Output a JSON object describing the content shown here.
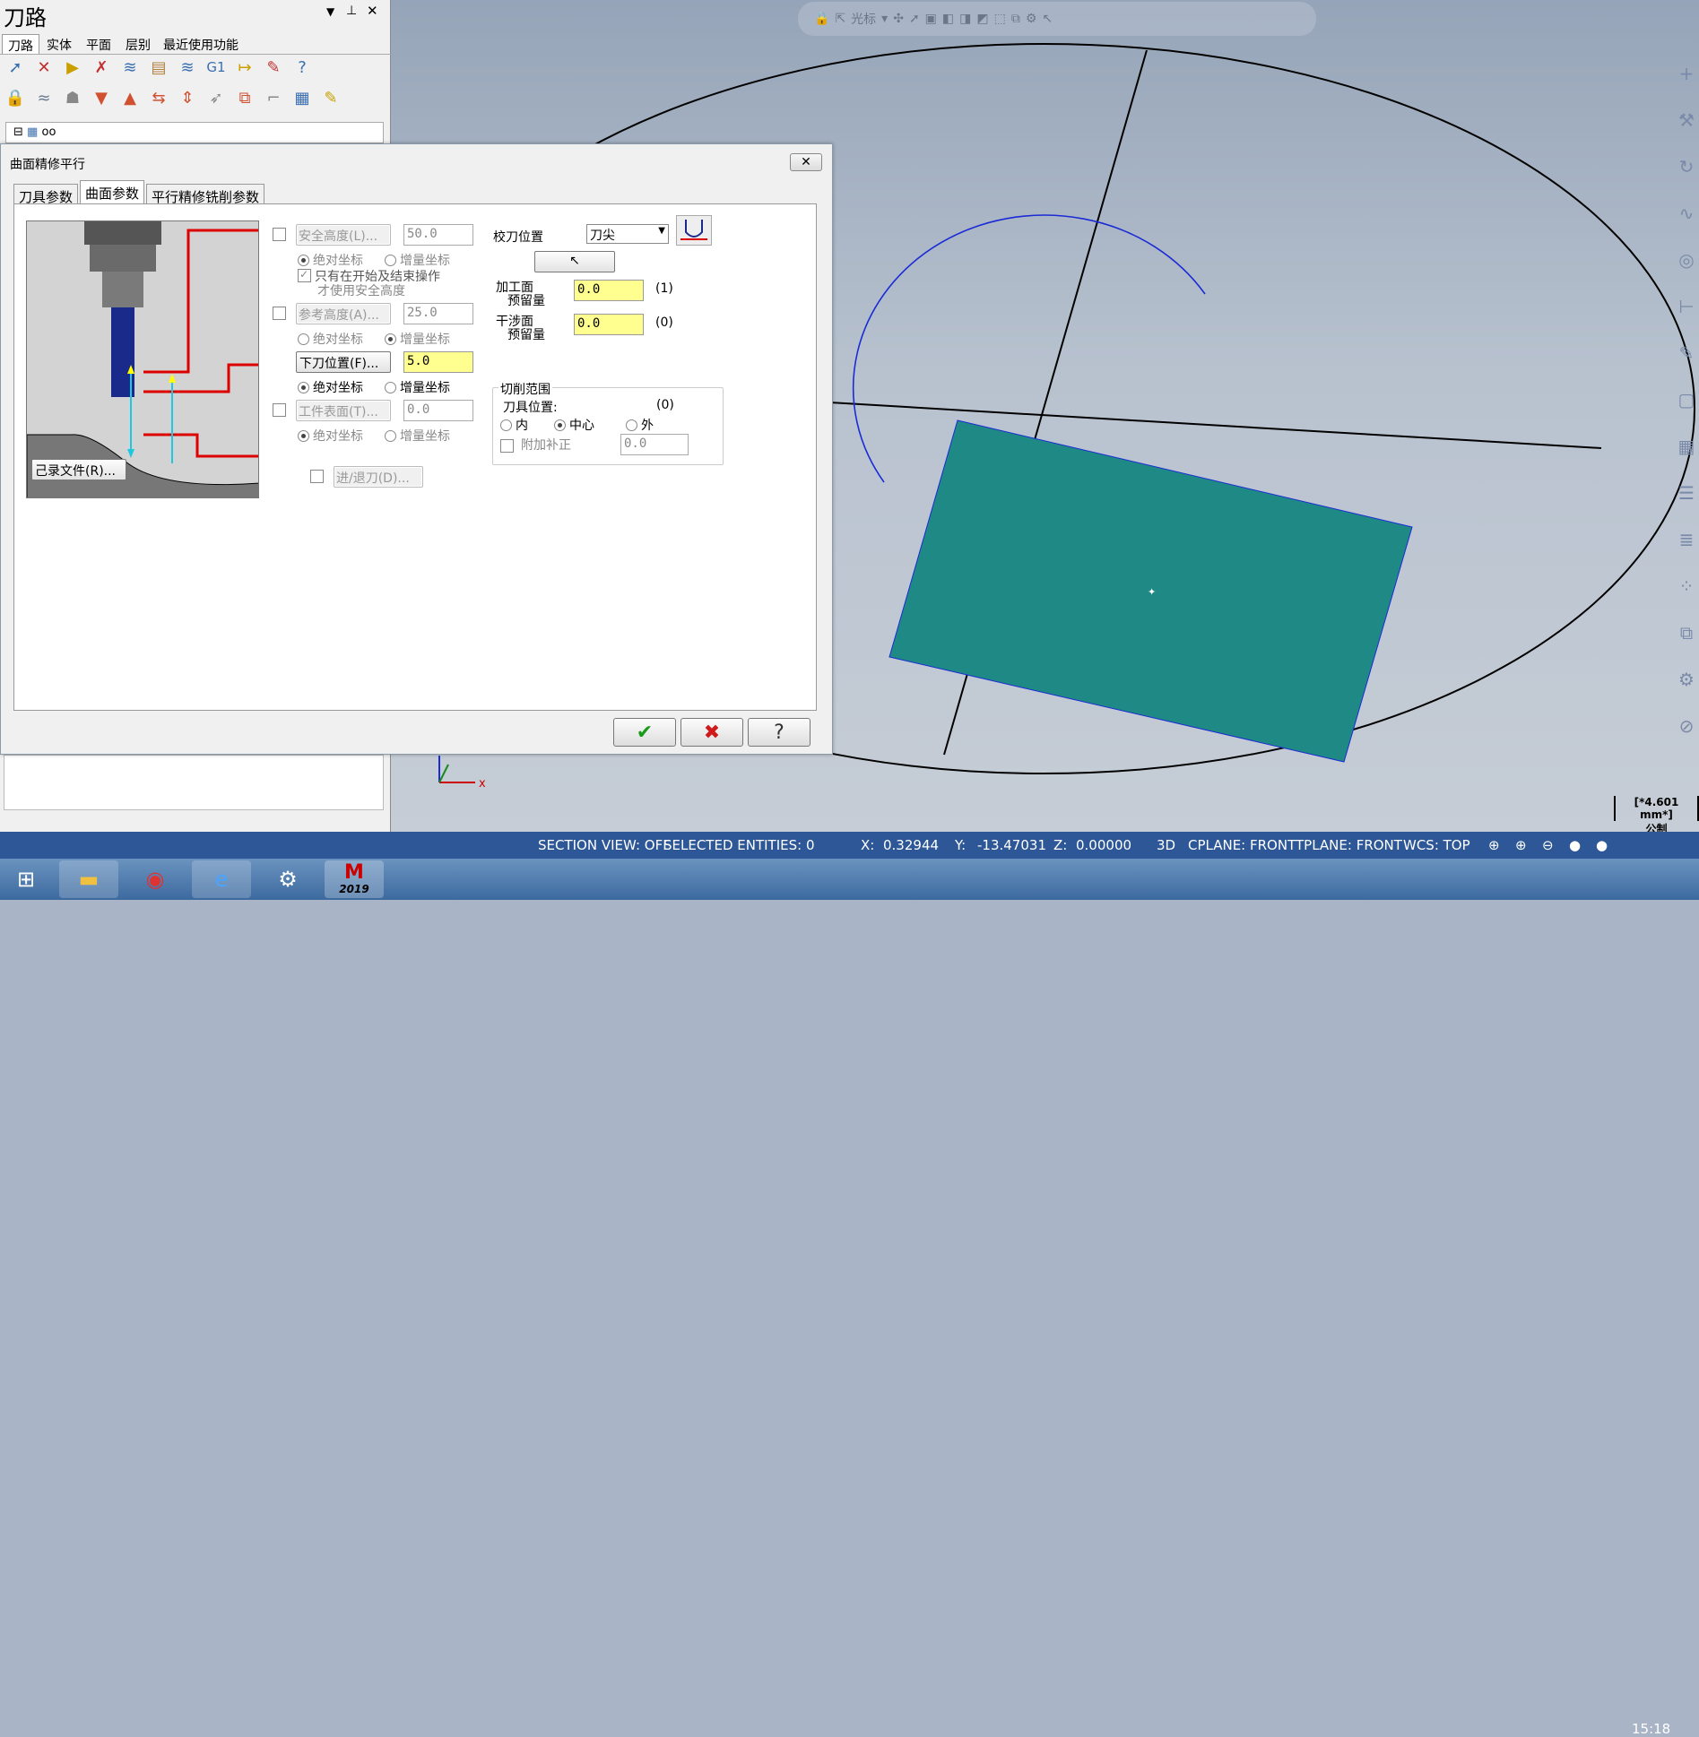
{
  "panel": {
    "title": "刀路",
    "tabs": [
      "刀路",
      "实体",
      "平面",
      "层别",
      "最近使用功能"
    ],
    "tree_item": "oo",
    "close": "✕",
    "pin": "⊥"
  },
  "viewport_toolbar": {
    "label": "光标"
  },
  "dialog": {
    "title": "曲面精修平行",
    "close": "✕",
    "tabs": [
      "刀具参数",
      "曲面参数",
      "平行精修铣削参数"
    ],
    "clearance": {
      "button": "安全高度(L)...",
      "value": "50.0",
      "abs": "绝对坐标",
      "inc": "增量坐标",
      "only_start_end_1": "只有在开始及结束操作",
      "only_start_end_2": "才使用安全高度"
    },
    "retract": {
      "button": "参考高度(A)...",
      "value": "25.0",
      "abs": "绝对坐标",
      "inc": "增量坐标"
    },
    "feed_plane": {
      "button": "下刀位置(F)...",
      "value": "5.0",
      "abs": "绝对坐标",
      "inc": "增量坐标"
    },
    "top_stock": {
      "button": "工件表面(T)...",
      "value": "0.0",
      "abs": "绝对坐标",
      "inc": "增量坐标"
    },
    "record_file": "己录文件(R)...",
    "entry_exit": "进/退刀(D)...",
    "tip_comp": {
      "label": "校刀位置",
      "value": "刀尖"
    },
    "drive_stock": {
      "label1": "加工面",
      "label2": "预留量",
      "value": "0.0",
      "count": "(1)"
    },
    "check_stock": {
      "label1": "干涉面",
      "label2": "预留量",
      "value": "0.0",
      "count": "(0)"
    },
    "containment": {
      "title": "切削范围",
      "tool_pos": "刀具位置:",
      "count": "(0)",
      "inside": "内",
      "center": "中心",
      "outside": "外",
      "add_offset": "附加补正",
      "offset_value": "0.0"
    }
  },
  "status": {
    "section": "SECTION VIEW: OFF",
    "selected": "SELECTED ENTITIES: 0",
    "x_label": "X:",
    "x": "0.32944",
    "y_label": "Y:",
    "y": "-13.47031",
    "z_label": "Z:",
    "z": "0.00000",
    "mode": "3D",
    "cplane": "CPLANE: FRONT",
    "tplane": "TPLANE: FRONT",
    "wcs": "WCS: TOP"
  },
  "scale": {
    "value": "[*4.601 mm*]",
    "unit": "公制"
  },
  "taskbar": {
    "time": "15:18",
    "mastercam_year": "2019"
  },
  "colors": {
    "surface": "#1f8a85",
    "statusbar": "#2d5796",
    "yellow_field": "#ffff90"
  }
}
